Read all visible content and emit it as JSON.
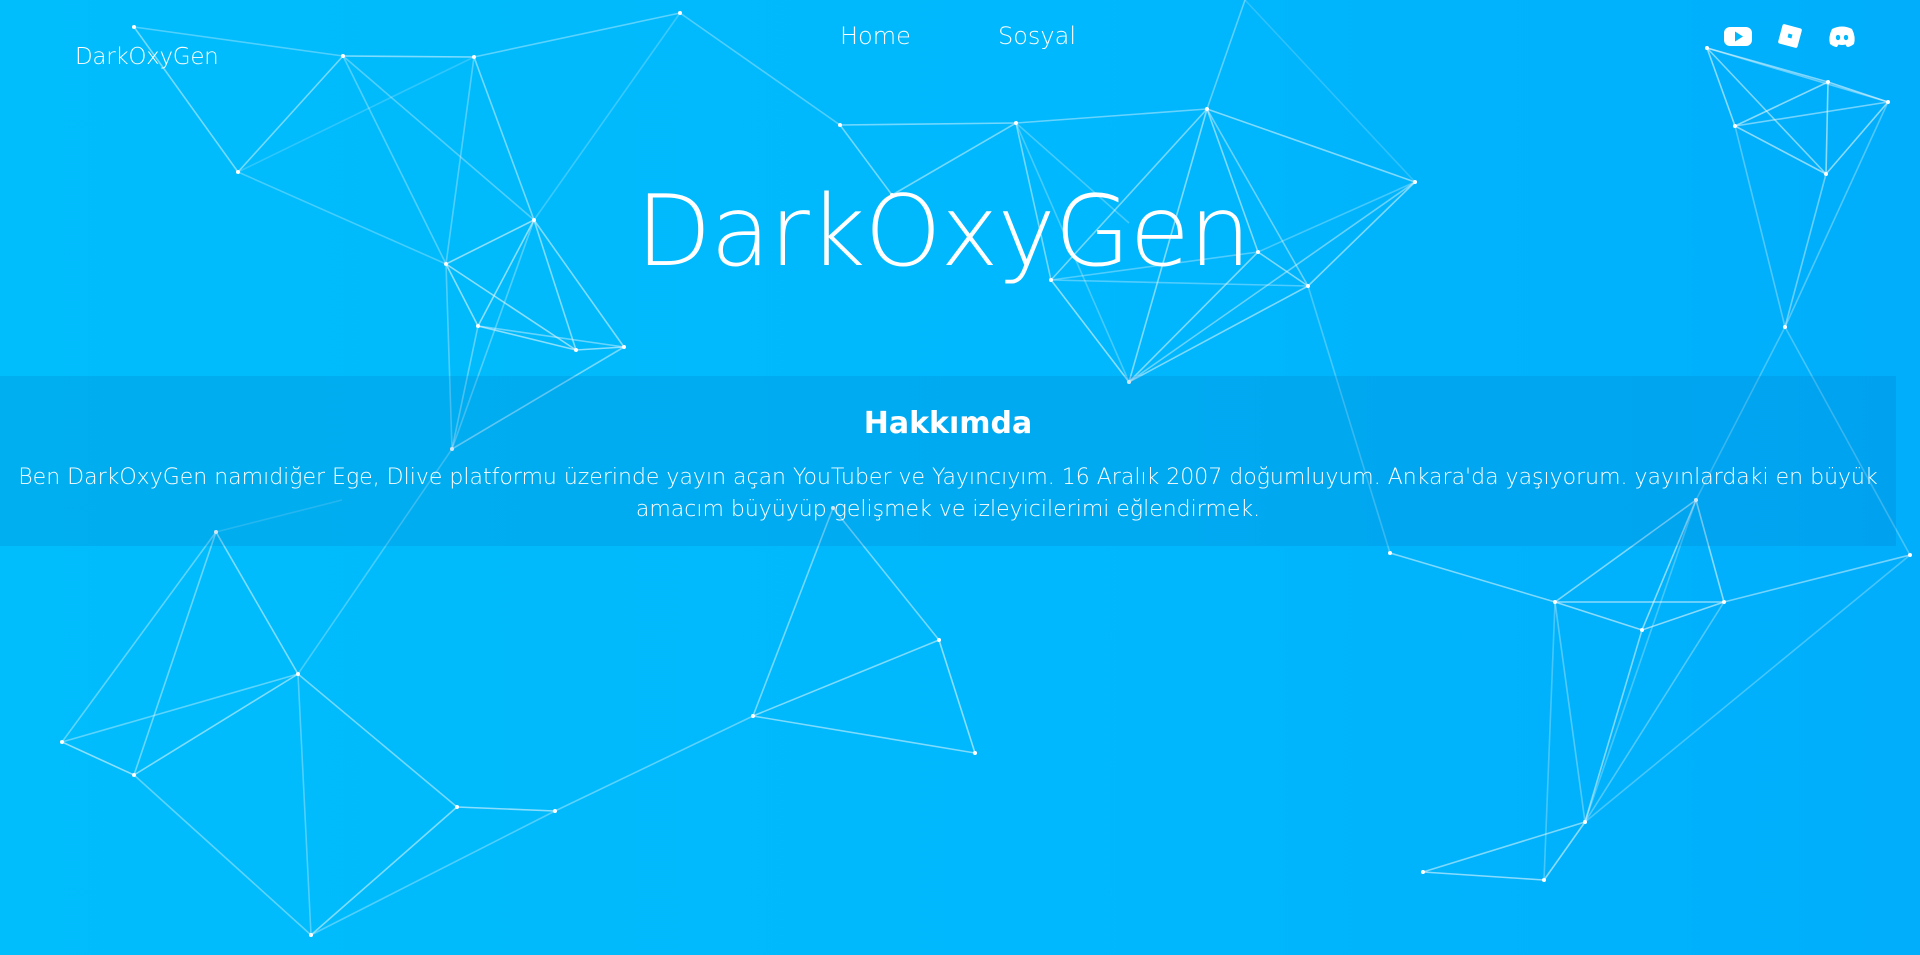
{
  "header": {
    "brand": "DarkOxyGen",
    "nav": [
      {
        "label": "Home"
      },
      {
        "label": "Sosyal"
      }
    ],
    "social_icons": [
      "youtube-icon",
      "roblox-icon",
      "discord-icon"
    ]
  },
  "hero": {
    "title": "DarkOxyGen"
  },
  "about": {
    "heading": "Hakkımda",
    "text": "Ben DarkOxyGen namıdiğer Ege, Dlive platformu üzerinde yayın açan YouTuber ve Yayıncıyım. 16 Aralık 2007 doğumluyum. Ankara'da yaşıyorum. yayınlardaki en büyük amacım büyüyüp gelişmek ve izleyicilerimi eğlendirmek."
  },
  "colors": {
    "background_left": "#00bdfc",
    "background_right": "#00aefb",
    "text": "#ffffff",
    "network_lines": "#e6f7ff"
  }
}
